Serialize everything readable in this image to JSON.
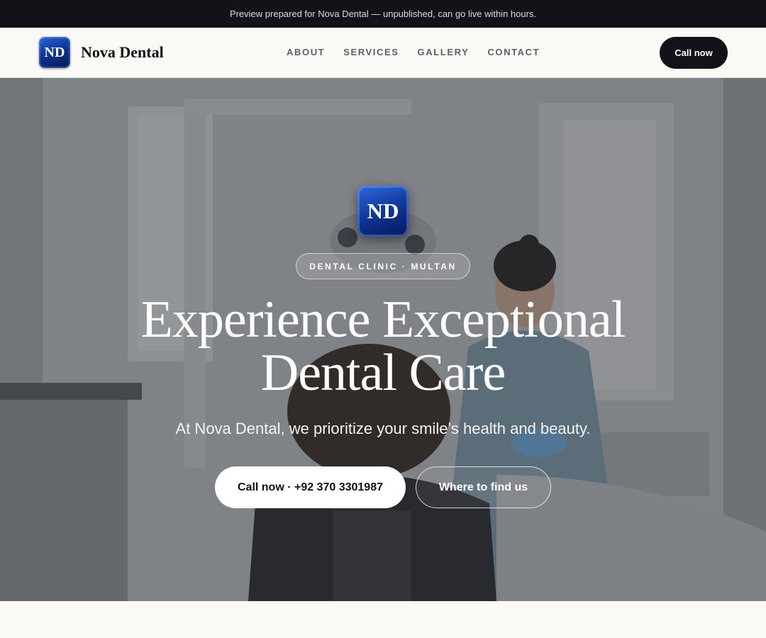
{
  "banner": {
    "text": "Preview prepared for Nova Dental — unpublished, can go live within hours."
  },
  "nav": {
    "logo_initials": "ND",
    "brand_name": "Nova Dental",
    "links": [
      "ABOUT",
      "SERVICES",
      "GALLERY",
      "CONTACT"
    ],
    "call_label": "Call now",
    "colors": {
      "bar": "#111318",
      "logo": "#0d2f86"
    }
  },
  "hero": {
    "logo_initials": "ND",
    "eyebrow": "DENTAL CLINIC · MULTAN",
    "headline_line1": "Experience Exceptional",
    "headline_line2": "Dental Care",
    "subheadline": "At Nova Dental, we prioritize your smile’s health and beauty.",
    "primary_cta": "Call now · +92 370 3301987",
    "secondary_cta": "Where to find us",
    "background_image": "dentist-treating-patient-photo"
  }
}
